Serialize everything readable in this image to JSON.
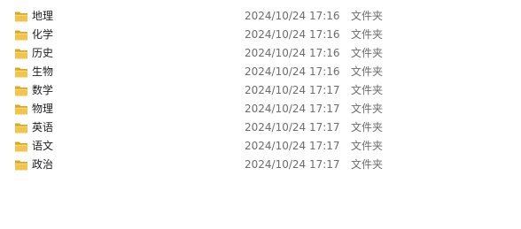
{
  "files": [
    {
      "name": "地理",
      "date": "2024/10/24 17:16",
      "type": "文件夹",
      "icon": "folder-icon"
    },
    {
      "name": "化学",
      "date": "2024/10/24 17:16",
      "type": "文件夹",
      "icon": "folder-icon"
    },
    {
      "name": "历史",
      "date": "2024/10/24 17:16",
      "type": "文件夹",
      "icon": "folder-icon"
    },
    {
      "name": "生物",
      "date": "2024/10/24 17:16",
      "type": "文件夹",
      "icon": "folder-icon"
    },
    {
      "name": "数学",
      "date": "2024/10/24 17:17",
      "type": "文件夹",
      "icon": "folder-icon"
    },
    {
      "name": "物理",
      "date": "2024/10/24 17:17",
      "type": "文件夹",
      "icon": "folder-icon"
    },
    {
      "name": "英语",
      "date": "2024/10/24 17:17",
      "type": "文件夹",
      "icon": "folder-icon"
    },
    {
      "name": "语文",
      "date": "2024/10/24 17:17",
      "type": "文件夹",
      "icon": "folder-icon"
    },
    {
      "name": "政治",
      "date": "2024/10/24 17:17",
      "type": "文件夹",
      "icon": "folder-icon"
    }
  ],
  "colors": {
    "folder_body": "#f2c44c",
    "folder_tab": "#d9a826",
    "folder_front": "#f8d874",
    "text": "#1e1e1e",
    "secondary_text": "#6d6d6d"
  }
}
